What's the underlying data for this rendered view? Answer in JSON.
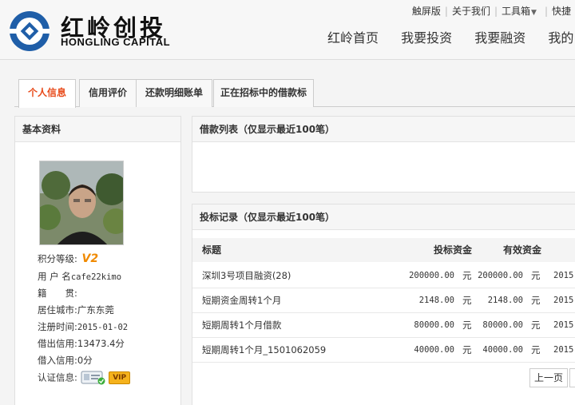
{
  "header": {
    "brand_cn": "红岭创投",
    "brand_en": "HONGLING CAPITAL",
    "top_links": {
      "touch": "触屏版",
      "about": "关于我们",
      "toolbox": "工具箱",
      "quick": "快捷"
    },
    "nav": [
      "红岭首页",
      "我要投资",
      "我要融资",
      "我的"
    ]
  },
  "tabs": [
    "个人信息",
    "信用评价",
    "还款明细账单",
    "正在招标中的借款标"
  ],
  "profile": {
    "title": "基本资料",
    "level_label": "积分等级:",
    "level_badge": "V2",
    "username_label": "用 户 名",
    "username": "cafe22kimo",
    "origin_label": "籍　　贯:",
    "origin": "",
    "city_label": "居住城市:",
    "city": "广东东莞",
    "reg_label": "注册时间:",
    "reg_date": "2015-01-02",
    "out_credit_label": "借出信用:",
    "out_credit": "13473.4分",
    "in_credit_label": "借入信用:",
    "in_credit": "0分",
    "cert_label": "认证信息:",
    "vip": "VIP"
  },
  "loan_list": {
    "title": "借款列表（仅显示最近100笔）"
  },
  "bids": {
    "title": "投标记录（仅显示最近100笔）",
    "columns": {
      "title": "标题",
      "amount": "投标资金",
      "effective": "有效资金"
    },
    "rows": [
      {
        "title": "深圳3号项目融资(28)",
        "amount": "200000.00",
        "unit1": "元",
        "effective": "200000.00",
        "unit2": "元",
        "date": "2015-"
      },
      {
        "title": "短期资金周转1个月",
        "amount": "2148.00",
        "unit1": "元",
        "effective": "2148.00",
        "unit2": "元",
        "date": "2015-"
      },
      {
        "title": "短期周转1个月借款",
        "amount": "80000.00",
        "unit1": "元",
        "effective": "80000.00",
        "unit2": "元",
        "date": "2015-"
      },
      {
        "title": "短期周转1个月_1501062059",
        "amount": "40000.00",
        "unit1": "元",
        "effective": "40000.00",
        "unit2": "元",
        "date": "2015-"
      }
    ],
    "prev_page": "上一页"
  },
  "colors": {
    "accent": "#e84b1b",
    "logo_blue": "#1f5ea8"
  },
  "icons": {
    "logo": "hongling-logo-icon",
    "id_card": "id-card-icon",
    "vip": "vip-badge-icon"
  }
}
